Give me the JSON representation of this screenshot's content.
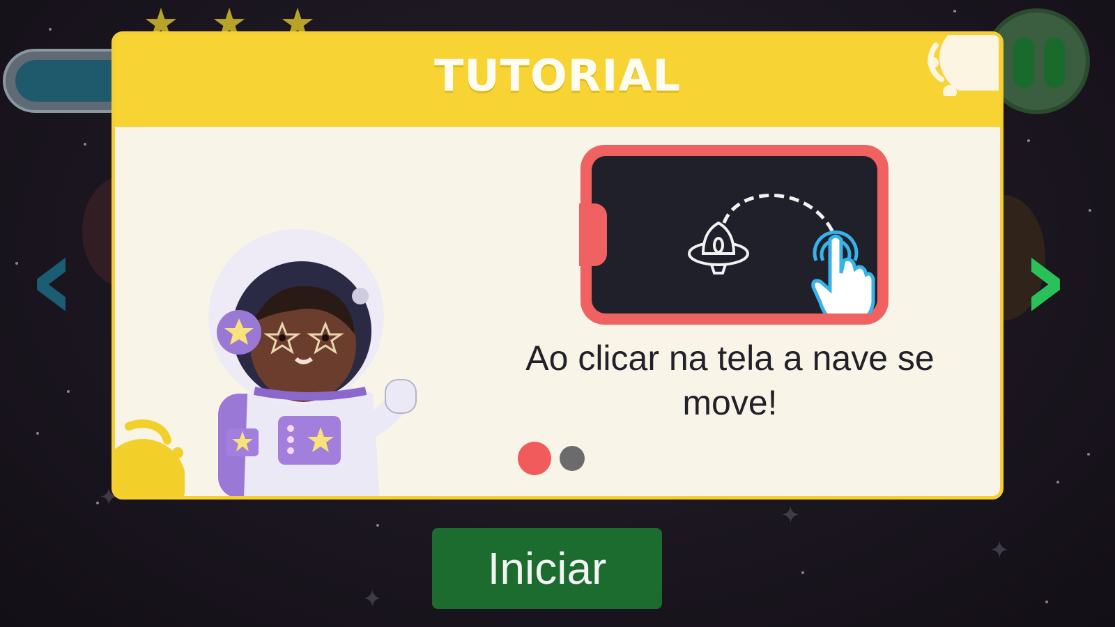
{
  "modal": {
    "title": "TUTORIAL",
    "description": "Ao clicar na tela a nave se move!",
    "pagination": {
      "current": 1,
      "total": 2
    }
  },
  "hud": {
    "stars_earned": 3,
    "pause_icon": "pause-icon",
    "prev_icon": "chevron-left-icon",
    "next_icon": "chevron-right-icon"
  },
  "start_button": {
    "label": "Iniciar"
  },
  "colors": {
    "header_yellow": "#f7d433",
    "modal_bg": "#f8f4e8",
    "phone_red": "#f06262",
    "active_dot": "#f25b5b",
    "start_green": "#1c6b2f",
    "next_arrow_green": "#29c25a",
    "prev_arrow_teal": "#1b5e74"
  }
}
